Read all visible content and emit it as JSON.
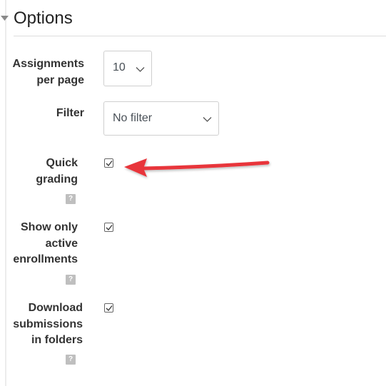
{
  "section": {
    "title": "Options",
    "icon": "caret-down-icon"
  },
  "fields": {
    "assignments_per_page": {
      "label_lines": [
        "Assignments",
        "per page"
      ],
      "selected_value": "10",
      "icon": "chevron-down-icon"
    },
    "filter": {
      "label_lines": [
        "Filter"
      ],
      "selected_value": "No filter",
      "icon": "chevron-down-icon"
    },
    "quick_grading": {
      "label_lines": [
        "Quick",
        "grading"
      ],
      "checked": true,
      "help_icon": "?"
    },
    "show_only_active_enrollments": {
      "label_lines": [
        "Show only",
        "active",
        "enrollments"
      ],
      "checked": true,
      "help_icon": "?"
    },
    "download_submissions_in_folders": {
      "label_lines": [
        "Download",
        "submissions",
        "in folders"
      ],
      "checked": true,
      "help_icon": "?"
    }
  },
  "annotation": {
    "icon": "red-arrow-icon",
    "color": "#e8343a"
  },
  "colors": {
    "text": "#333333",
    "border": "#cfcfcf",
    "help_icon": "#bfbfbf"
  }
}
